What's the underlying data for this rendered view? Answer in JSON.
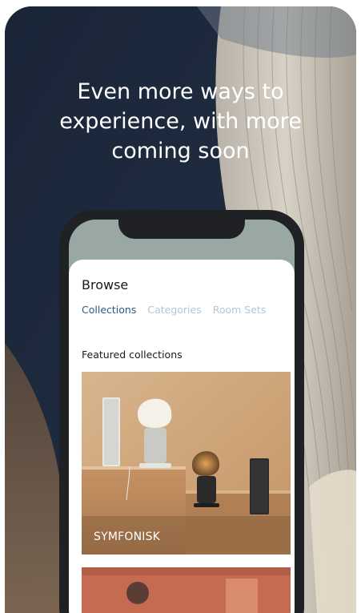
{
  "promo": {
    "headline_lines": [
      "Even more ways to",
      "experience, with more",
      "coming soon"
    ]
  },
  "app": {
    "browse_title": "Browse",
    "tabs": [
      {
        "label": "Collections",
        "active": true
      },
      {
        "label": "Categories",
        "active": false
      },
      {
        "label": "Room Sets",
        "active": false
      }
    ],
    "section_title": "Featured collections",
    "collections": [
      {
        "label": "SYMFONISK"
      }
    ]
  },
  "colors": {
    "tab_active": "#2d5a84",
    "tab_inactive": "#b4c6d6",
    "background_dark": "#1b2638",
    "phone_frame": "#1f2124"
  },
  "icons": []
}
